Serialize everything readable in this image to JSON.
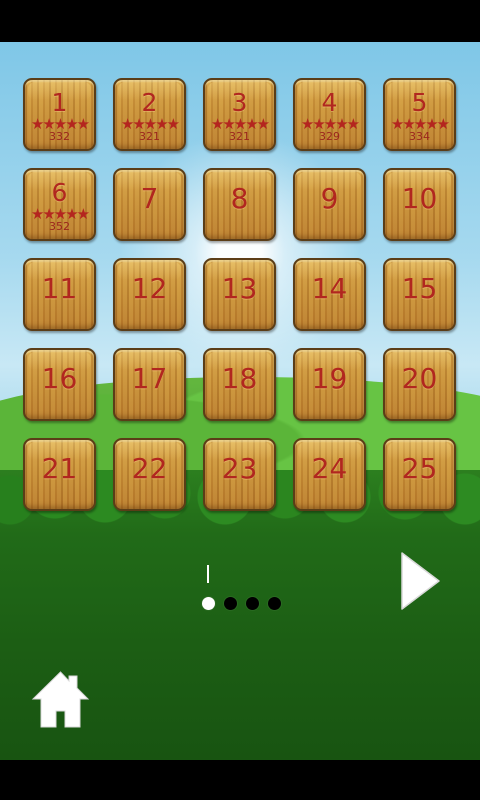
{
  "screen": {
    "title": ""
  },
  "levels": [
    {
      "number": "1",
      "stars": "★★★★★",
      "score": "332"
    },
    {
      "number": "2",
      "stars": "★★★★★",
      "score": "321"
    },
    {
      "number": "3",
      "stars": "★★★★★",
      "score": "321"
    },
    {
      "number": "4",
      "stars": "★★★★★",
      "score": "329"
    },
    {
      "number": "5",
      "stars": "★★★★★",
      "score": "334"
    },
    {
      "number": "6",
      "stars": "★★★★★",
      "score": "352"
    },
    {
      "number": "7"
    },
    {
      "number": "8"
    },
    {
      "number": "9"
    },
    {
      "number": "10"
    },
    {
      "number": "11"
    },
    {
      "number": "12"
    },
    {
      "number": "13"
    },
    {
      "number": "14"
    },
    {
      "number": "15"
    },
    {
      "number": "16"
    },
    {
      "number": "17"
    },
    {
      "number": "18"
    },
    {
      "number": "19"
    },
    {
      "number": "20"
    },
    {
      "number": "21"
    },
    {
      "number": "22"
    },
    {
      "number": "23"
    },
    {
      "number": "24"
    },
    {
      "number": "25"
    }
  ],
  "pagination": {
    "current_page": 1,
    "total_pages": 4
  },
  "buttons": {
    "next_icon": "play-arrow-icon",
    "home_icon": "home-icon"
  },
  "colors": {
    "tile_text": "#b1271f",
    "tile_wood": "#c78e36",
    "active_dot": "#ffffff",
    "inactive_dot": "#000000"
  }
}
